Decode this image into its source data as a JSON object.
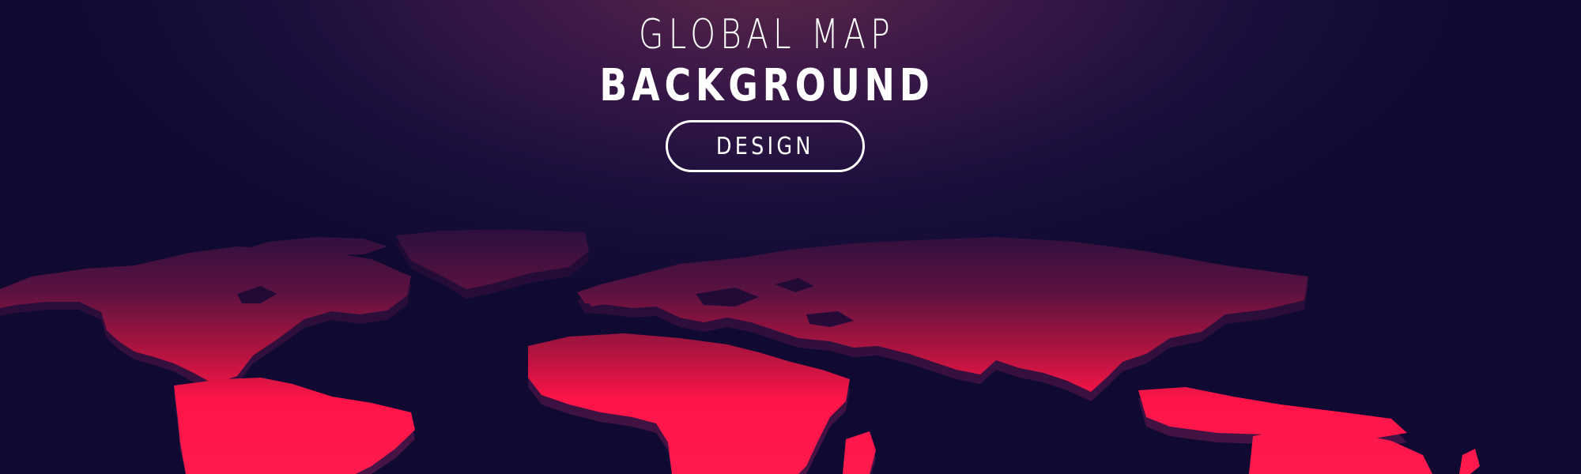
{
  "banner": {
    "title_line1": "GLOBAL MAP",
    "title_line2": "BACKGROUND",
    "pill_label": "DESIGN"
  },
  "colors": {
    "background": "#100a32",
    "glow": "#5e2846",
    "land_bright": "#ff1448",
    "land_dark": "#3e1444",
    "land_side": "#2a0c36",
    "text": "#ffffff"
  },
  "icons": [
    "world-map-3d-icon"
  ]
}
